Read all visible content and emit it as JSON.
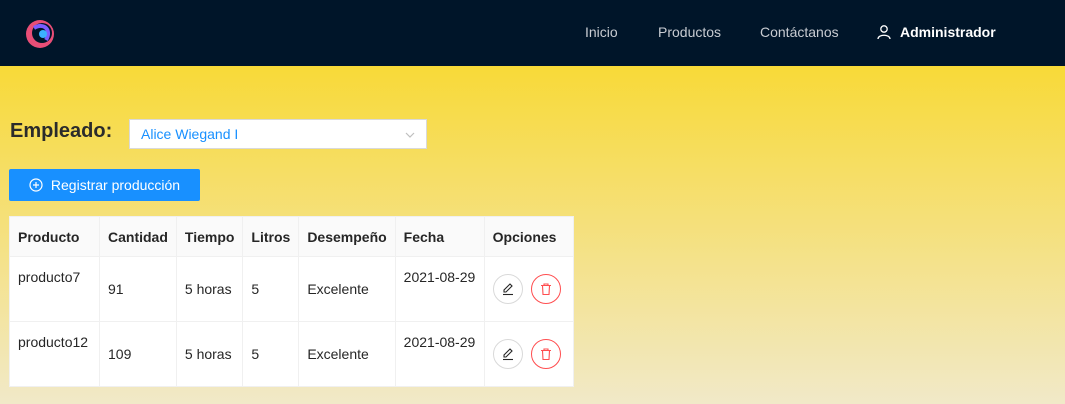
{
  "nav": {
    "links": [
      "Inicio",
      "Productos",
      "Contáctanos"
    ],
    "user_label": "Administrador"
  },
  "filter": {
    "label": "Empleado:",
    "selected": "Alice Wiegand I"
  },
  "actions": {
    "register_label": "Registrar producción"
  },
  "table": {
    "headers": [
      "Producto",
      "Cantidad",
      "Tiempo",
      "Litros",
      "Desempeño",
      "Fecha",
      "Opciones"
    ],
    "rows": [
      [
        "producto7",
        "91",
        "5 horas",
        "5",
        "Excelente",
        "2021-08-29"
      ],
      [
        "producto12",
        "109",
        "5 horas",
        "5",
        "Excelente",
        "2021-08-29"
      ]
    ]
  },
  "colors": {
    "navbar": "#001529",
    "primary": "#1890ff",
    "danger": "#ff4d4f"
  },
  "icons": [
    "app-logo-icon",
    "user-icon",
    "chevron-down-icon",
    "plus-circle-icon",
    "edit-icon",
    "delete-icon"
  ]
}
